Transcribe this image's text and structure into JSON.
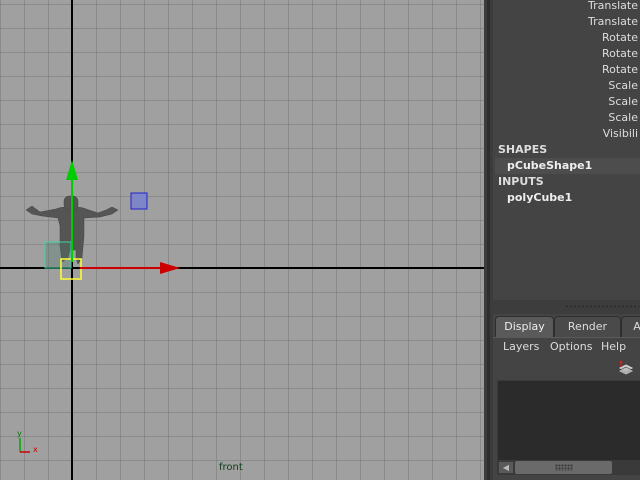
{
  "viewport": {
    "camera_label": "front",
    "axis_labels": {
      "y": "y",
      "x": "x"
    },
    "colors": {
      "background": "#a0a0a0",
      "grid": "#8a8a8a",
      "axis_x": "#cc0000",
      "axis_y": "#00aa00",
      "camera_label": "#0b3d17"
    }
  },
  "channel_box": {
    "attributes": [
      "Translate",
      "Translate",
      "Rotate",
      "Rotate",
      "Rotate",
      "Scale",
      "Scale",
      "Scale",
      "Visibili"
    ],
    "shapes_header": "SHAPES",
    "shape_node": "pCubeShape1",
    "inputs_header": "INPUTS",
    "input_node": "polyCube1"
  },
  "layer_editor": {
    "tabs": [
      "Display",
      "Render",
      "A"
    ],
    "active_tab": "Display",
    "menu": [
      "Layers",
      "Options",
      "Help"
    ],
    "icons": {
      "new_layer": "layers-stack-icon",
      "scroll_left": "arrow-left-icon"
    }
  }
}
